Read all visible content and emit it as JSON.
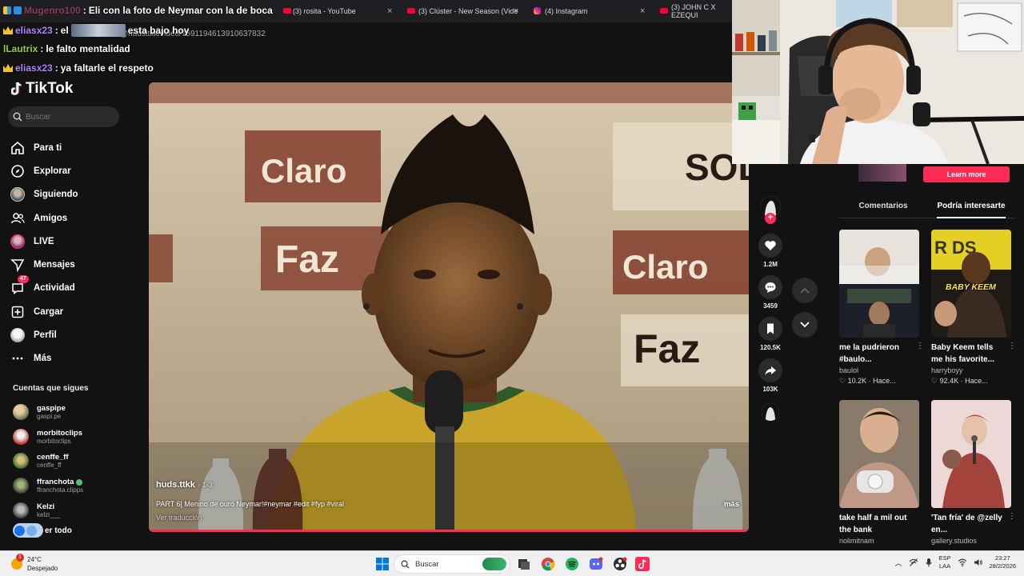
{
  "browser_tabs": [
    {
      "label": "(3) rosita - YouTube",
      "icon": "youtube-icon"
    },
    {
      "label": "(3) Clúster - New Season (Vide",
      "icon": "youtube-icon"
    },
    {
      "label": "(4) Instagram",
      "icon": "instagram-icon"
    },
    {
      "label": "(3) JOHN C X EZEQUI",
      "icon": "youtube-icon"
    }
  ],
  "tab_close": "×",
  "url_fragment": "@hudsttkk/video/7591194613910637832",
  "chat": [
    {
      "user": "Mugenro100",
      "sep": ":",
      "message": "Eli con la foto de Neymar con la de boca",
      "color": "#ff5f9e"
    },
    {
      "user": "eliasx23",
      "sep": ":",
      "message_pre": "el",
      "message": "esta bajo hoy",
      "color": "#b281ff"
    },
    {
      "user": "lLautrix",
      "sep": ":",
      "message": "le falto mentalidad",
      "color": "#9acd32"
    },
    {
      "user": "eliasx23",
      "sep": ":",
      "message": "ya faltarle el respeto",
      "color": "#b281ff"
    }
  ],
  "tiktok": {
    "logo": "TikTok",
    "search_placeholder": "Buscar",
    "nav": [
      {
        "label": "Para ti",
        "icon": "home-icon"
      },
      {
        "label": "Explorar",
        "icon": "compass-icon"
      },
      {
        "label": "Siguiendo",
        "icon": "following-avatar-icon"
      },
      {
        "label": "Amigos",
        "icon": "friends-icon"
      },
      {
        "label": "LIVE",
        "icon": "live-avatar-icon"
      },
      {
        "label": "Mensajes",
        "icon": "send-icon"
      },
      {
        "label": "Actividad",
        "icon": "inbox-icon",
        "badge": "47"
      },
      {
        "label": "Cargar",
        "icon": "upload-icon"
      },
      {
        "label": "Perfil",
        "icon": "profile-icon"
      },
      {
        "label": "Más",
        "icon": "more-icon"
      }
    ],
    "following_title": "Cuentas que sigues",
    "following": [
      {
        "name": "gaspipe",
        "handle": "gaspi.pe",
        "verified": false
      },
      {
        "name": "morbitoclips",
        "handle": "morbitoclips",
        "verified": false
      },
      {
        "name": "cenffe_ff",
        "handle": "cenffe_ff",
        "verified": false
      },
      {
        "name": "ffranchota",
        "handle": "ffranchota.clipps",
        "verified": true
      },
      {
        "name": "Kelzi",
        "handle": "kelzi___",
        "verified": false
      }
    ],
    "see_all": "er todo"
  },
  "video": {
    "author": "huds.ttkk",
    "age": "· 1-3",
    "description": "PART 6| Menino de ouro Neymar!#neymar #edit #fyp #viral",
    "translate": "Ver traducción",
    "more": "más",
    "progress": 1.0,
    "backdrop_words": [
      "Claro",
      "Faz",
      "SOL"
    ]
  },
  "actions": {
    "likes": "1.2M",
    "comments": "3459",
    "saves": "120.5K",
    "shares": "103K"
  },
  "right_panel": {
    "learn_more": "Learn more",
    "tabs": [
      "Comentarios",
      "Podría interesarte"
    ],
    "active_tab": 1,
    "recommendations": [
      {
        "title": "me la pudrieron #baulo...",
        "author": "baulol",
        "stat": "10.2K · Hace...",
        "overlay": ""
      },
      {
        "title": "Baby Keem tells me his favorite...",
        "author": "harryboyy",
        "stat": "92.4K · Hace...",
        "overlay": "BABY KEEM"
      },
      {
        "title": "take half a mil out the bank",
        "author": "nolimitnam",
        "stat": "",
        "overlay": ""
      },
      {
        "title": "'Tan fría' de @zelly en...",
        "author": "gallery.studios",
        "stat": "",
        "overlay": ""
      }
    ],
    "more_glyph": "⋮"
  },
  "taskbar": {
    "weather_badge": "1",
    "temperature": "24°C",
    "weather": "Despejado",
    "search_placeholder": "Buscar",
    "lang_top": "ESP",
    "lang_bottom": "LAA",
    "time": "23:27",
    "date": "28/2/2026"
  },
  "colors": {
    "accent": "#fe2c55",
    "background": "#121212"
  }
}
